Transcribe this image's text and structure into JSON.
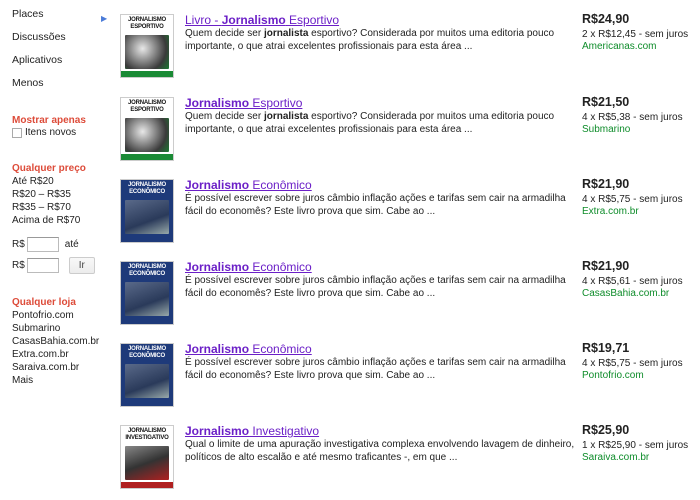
{
  "sidebar": {
    "nav": [
      "Places",
      "Discussões",
      "Aplicativos",
      "Menos"
    ],
    "show_only": {
      "title": "Mostrar apenas",
      "checkbox_label": "Itens novos"
    },
    "price": {
      "title": "Qualquer preço",
      "options": [
        "Até R$20",
        "R$20 – R$35",
        "R$35 – R$70",
        "Acima de R$70"
      ],
      "currency1": "R$",
      "until": "até",
      "currency2": "R$",
      "go": "Ir"
    },
    "store": {
      "title": "Qualquer loja",
      "options": [
        "Pontofrio.com",
        "Submarino",
        "CasasBahia.com.br",
        "Extra.com.br",
        "Saraiva.com.br",
        "Mais"
      ]
    }
  },
  "results": [
    {
      "title_pre": "Livro - ",
      "title_bold": "Jornalismo",
      "title_post": " Esportivo",
      "desc_pre": "Quem decide ser ",
      "desc_bold": "jornalista",
      "desc_post": " esportivo? Considerada por muitos uma editoria pouco importante, o que atrai excelentes profissionais para esta área ...",
      "price": "R$24,90",
      "installments": "2 x R$12,45 - sem juros",
      "store": "Americanas.com",
      "cover_title": "JORNALISMO ESPORTIVO"
    },
    {
      "title_pre": "",
      "title_bold": "Jornalismo",
      "title_post": " Esportivo",
      "desc_pre": "Quem decide ser ",
      "desc_bold": "jornalista",
      "desc_post": " esportivo? Considerada por muitos uma editoria pouco importante, o que atrai excelentes profissionais para esta área ...",
      "price": "R$21,50",
      "installments": "4 x R$5,38 - sem juros",
      "store": "Submarino",
      "cover_title": "JORNALISMO ESPORTIVO"
    },
    {
      "title_pre": "",
      "title_bold": "Jornalismo",
      "title_post": " Econômico",
      "desc_pre": "",
      "desc_bold": "",
      "desc_post": "É possível escrever sobre juros câmbio inflação ações e tarifas sem cair na armadilha fácil do economês? Este livro prova que sim. Cabe ao ...",
      "price": "R$21,90",
      "installments": "4 x R$5,75 - sem juros",
      "store": "Extra.com.br",
      "cover_title": "JORNALISMO ECONÔMICO"
    },
    {
      "title_pre": "",
      "title_bold": "Jornalismo",
      "title_post": " Econômico",
      "desc_pre": "",
      "desc_bold": "",
      "desc_post": "É possível escrever sobre juros câmbio inflação ações e tarifas sem cair na armadilha fácil do economês? Este livro prova que sim. Cabe ao ...",
      "price": "R$21,90",
      "installments": "4 x R$5,61 - sem juros",
      "store": "CasasBahia.com.br",
      "cover_title": "JORNALISMO ECONÔMICO"
    },
    {
      "title_pre": "",
      "title_bold": "Jornalismo",
      "title_post": " Econômico",
      "desc_pre": "",
      "desc_bold": "",
      "desc_post": "É possível escrever sobre juros câmbio inflação ações e tarifas sem cair na armadilha fácil do economês? Este livro prova que sim. Cabe ao ...",
      "price": "R$19,71",
      "installments": "4 x R$5,75 - sem juros",
      "store": "Pontofrio.com",
      "cover_title": "JORNALISMO ECONÔMICO"
    },
    {
      "title_pre": "",
      "title_bold": "Jornalismo",
      "title_post": " Investigativo",
      "desc_pre": "",
      "desc_bold": "",
      "desc_post": "Qual o limite de uma apuração investigativa complexa envolvendo lavagem de dinheiro, políticos de alto escalão e até mesmo traficantes -, em que ...",
      "price": "R$25,90",
      "installments": "1 x R$25,90 - sem juros",
      "store": "Saraiva.com.br",
      "cover_title": "JORNALISMO INVESTIGATIVO"
    }
  ],
  "colors": {
    "link": "#6b1fc7",
    "store": "#0e8c2a",
    "section_title": "#dd4b39"
  }
}
